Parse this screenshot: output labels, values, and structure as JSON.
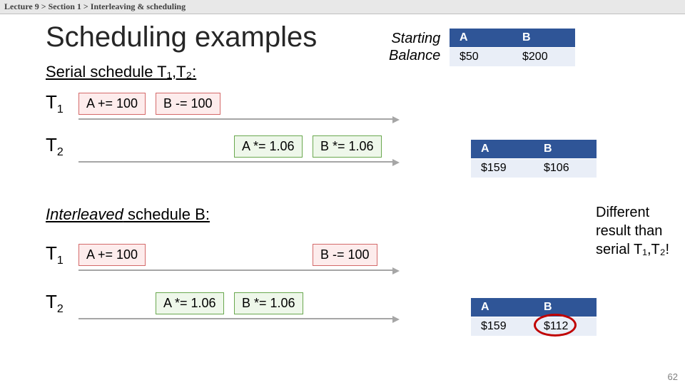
{
  "breadcrumb": "Lecture 9  >  Section 1  >  Interleaving & scheduling",
  "title": "Scheduling examples",
  "serial_heading": "Serial schedule T₁,T₂:",
  "interleaved_heading_em": "Interleaved",
  "interleaved_heading_rest": " schedule B:",
  "labels": {
    "t1": "T",
    "t2": "T",
    "sub1": "1",
    "sub2": "2"
  },
  "ops": {
    "a_inc": "A += 100",
    "b_dec": "B -= 100",
    "a_mul": "A *= 1.06",
    "b_mul": "B *= 1.06"
  },
  "starting": {
    "line1": "Starting",
    "line2": "Balance"
  },
  "table_start": {
    "h1": "A",
    "h2": "B",
    "v1": "$50",
    "v2": "$200"
  },
  "table_serial": {
    "h1": "A",
    "h2": "B",
    "v1": "$159",
    "v2": "$106"
  },
  "table_inter": {
    "h1": "A",
    "h2": "B",
    "v1": "$159",
    "v2": "$112"
  },
  "callout": "Different result than serial T₁,T₂!",
  "page": "62"
}
